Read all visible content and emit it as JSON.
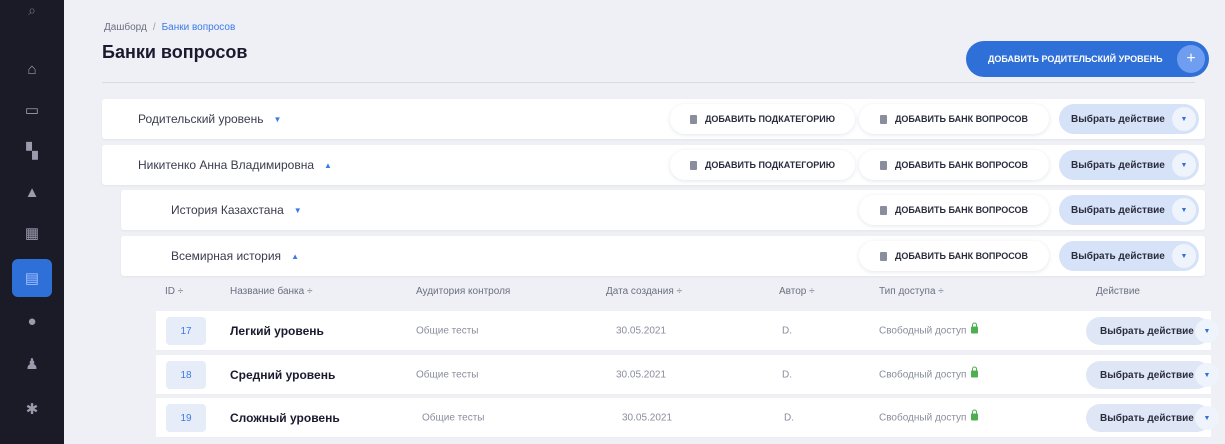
{
  "sidebar": {
    "search_icon": "search-icon",
    "items": [
      {
        "icon": "home-icon",
        "glyph": "⌂"
      },
      {
        "icon": "monitor-icon",
        "glyph": "▭"
      },
      {
        "icon": "books-icon",
        "glyph": "▚"
      },
      {
        "icon": "graduation-icon",
        "glyph": "▲"
      },
      {
        "icon": "dashboard-icon",
        "glyph": "▦"
      },
      {
        "icon": "question-bank-icon",
        "glyph": "▤",
        "active": true
      },
      {
        "icon": "user-icon",
        "glyph": "●"
      },
      {
        "icon": "person-icon",
        "glyph": "♟"
      },
      {
        "icon": "group-icon",
        "glyph": "✱"
      }
    ]
  },
  "header": {
    "breadcrumb": {
      "root": "Дашборд",
      "separator": "/",
      "current": "Банки вопросов"
    },
    "title": "Банки вопросов",
    "add_parent_label": "Добавить родительский уровень",
    "add_parent_plus": "+"
  },
  "levels": [
    {
      "label": "Родительский уровень",
      "caret": "▼",
      "add_subcategory": "Добавить подкатегорию",
      "add_bank": "Добавить банк вопросов",
      "action": "Выбрать действие"
    },
    {
      "label": "Никитенко Анна Владимировна",
      "caret": "▲",
      "add_subcategory": "Добавить подкатегорию",
      "add_bank": "Добавить банк вопросов",
      "action": "Выбрать действие"
    },
    {
      "label": "История Казахстана",
      "caret": "▼",
      "add_bank": "Добавить банк вопросов",
      "action": "Выбрать действие"
    },
    {
      "label": "Всемирная история",
      "caret": "▲",
      "add_bank": "Добавить банк вопросов",
      "action": "Выбрать действие"
    }
  ],
  "table": {
    "headers": {
      "id": "ID ÷",
      "name": "Название банка ÷",
      "audience": "Аудитория контроля",
      "created": "Дата создания ÷",
      "author": "Автор ÷",
      "access": "Тип доступа ÷",
      "action": "Действие"
    },
    "rows": [
      {
        "id": "17",
        "name": "Легкий уровень",
        "audience": "Общие тесты",
        "created": "30.05.2021",
        "author": "D.",
        "access": "Свободный доступ",
        "action": "Выбрать действие"
      },
      {
        "id": "18",
        "name": "Средний уровень",
        "audience": "Общие тесты",
        "created": "30.05.2021",
        "author": "D.",
        "access": "Свободный доступ",
        "action": "Выбрать действие"
      },
      {
        "id": "19",
        "name": "Сложный уровень",
        "audience": "Общие тесты",
        "created": "30.05.2021",
        "author": "D.",
        "access": "Свободный доступ",
        "action": "Выбрать действие"
      }
    ]
  },
  "colors": {
    "accent": "#2f6fd8",
    "sidebar": "#1b1b28",
    "access_ok": "#4caf50"
  }
}
